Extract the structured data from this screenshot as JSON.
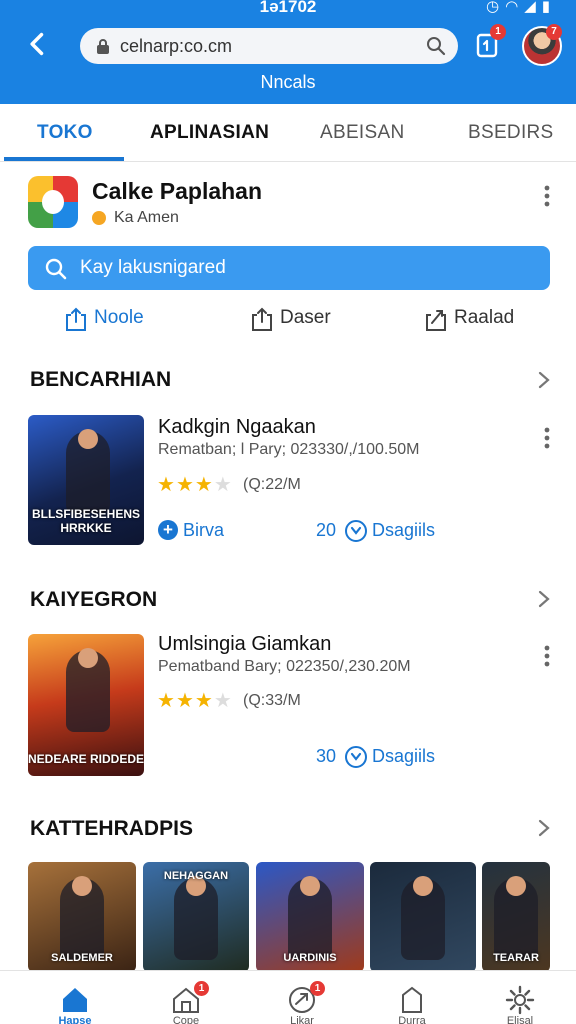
{
  "status_bar": {
    "time": "1ə1702",
    "icons": [
      "clock-icon",
      "wifi-icon",
      "signal-icon",
      "battery-icon"
    ]
  },
  "browser": {
    "url": "celnarp:co.cm",
    "tabs_count": "1",
    "avatar_badge": "7",
    "subtitle": "Nncals"
  },
  "tabs": [
    {
      "label": "TOKO",
      "active": true
    },
    {
      "label": "APLINASIAN",
      "active": false
    },
    {
      "label": "ABEISAN",
      "active": false
    },
    {
      "label": "BSEDIRS",
      "active": false
    }
  ],
  "app": {
    "name": "Calke Paplahan",
    "developer": "Ka Amen",
    "search_placeholder": "Kay lakusnigared",
    "actions": [
      {
        "label": "Noole",
        "icon": "share-icon"
      },
      {
        "label": "Daser",
        "icon": "share-icon"
      },
      {
        "label": "Raalad",
        "icon": "upload-icon"
      }
    ]
  },
  "sections": [
    {
      "title": "BENCARHIAN",
      "item": {
        "thumb_caption": "BLLSFIBESEHENS HRRKKE",
        "title": "Kadkgin Ngaakan",
        "meta": "Rematban; l Pary; 023330/,/100.50M",
        "rating_stars": 3,
        "rating_text": "(Q:22/M",
        "install_label": "Birva",
        "downloads_num": "20",
        "downloads_label": "Dsagiils"
      }
    },
    {
      "title": "KAIYEGRON",
      "item": {
        "thumb_caption": "NEDEARE RIDDEDE",
        "title": "Umlsingia Giamkan",
        "meta": "Pematband Bary; 022350/,230.20M",
        "rating_stars": 3,
        "rating_text": "(Q:33/M",
        "downloads_num": "30",
        "downloads_label": "Dsagiils"
      }
    },
    {
      "title": "KATTEHRADPIS",
      "carousel": [
        {
          "caption": "SALDEMER"
        },
        {
          "caption": "NEHAGGAN"
        },
        {
          "caption": "UARDINIS"
        },
        {
          "caption": ""
        },
        {
          "caption": "TEARAR"
        }
      ]
    }
  ],
  "bottom_nav": [
    {
      "label": "Hapse",
      "icon": "home-icon",
      "active": true
    },
    {
      "label": "Cope",
      "icon": "store-icon",
      "badge": "1"
    },
    {
      "label": "Likar",
      "icon": "refresh-icon",
      "badge": "1"
    },
    {
      "label": "Durra",
      "icon": "bookmark-icon"
    },
    {
      "label": "Elisal",
      "icon": "gear-icon"
    }
  ],
  "colors": {
    "brand_blue": "#1a82e2",
    "accent": "#1976d2",
    "search_blue": "#3a9af0",
    "star": "#f5b301",
    "badge_red": "#e53935"
  }
}
